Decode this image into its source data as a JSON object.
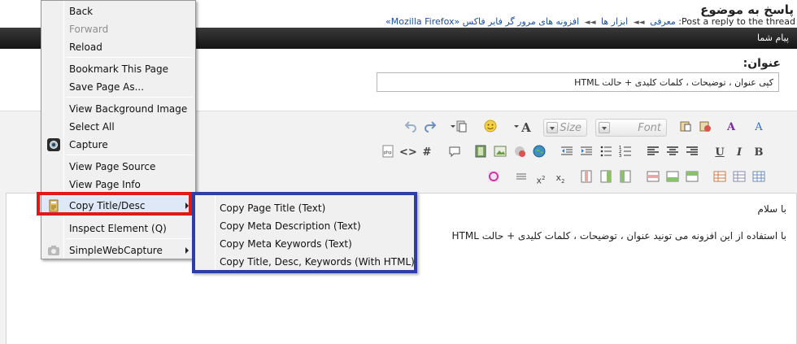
{
  "page": {
    "title": "پاسخ به موضوع",
    "breadcrumb": {
      "thread_label": "Post a reply to the thread:",
      "intro": "معرفی",
      "tools": "ابزار ها",
      "addons": "افزونه های مرور گر فایر فاکس",
      "topic": "«Mozilla Firefox»"
    },
    "your_message": "پیام شما"
  },
  "subject": {
    "label": "عنوان:",
    "value": "کپی عنوان ، توضیحات ، کلمات کلیدی + حالت HTML"
  },
  "editor": {
    "size_label": "Size",
    "font_label": "Font",
    "colors": {
      "accent_red": "#c0392b",
      "accent_blue": "#2d6bd1"
    },
    "body_lines": [
      "با سلام",
      "با استفاده از این افزونه می تونید عنوان ، توضیحات ، کلمات کلیدی + حالت HTML"
    ]
  },
  "context_menu": {
    "back": "Back",
    "forward": "Forward",
    "reload": "Reload",
    "bookmark": "Bookmark This Page",
    "save_as": "Save Page As...",
    "view_background": "View Background Image",
    "select_all": "Select All",
    "capture": "Capture",
    "view_source": "View Page Source",
    "view_info": "View Page Info",
    "copy_title_desc": "Copy Title/Desc",
    "inspect": "Inspect Element (Q)",
    "simple_capture": "SimpleWebCapture"
  },
  "submenu": {
    "items": [
      "Copy Page Title (Text)",
      "Copy Meta Description (Text)",
      "Copy Meta Keywords (Text)",
      "Copy Title, Desc, Keywords (With HTML)"
    ]
  },
  "highlight_colors": {
    "red": "#e01818",
    "blue": "#2d3ea8"
  }
}
